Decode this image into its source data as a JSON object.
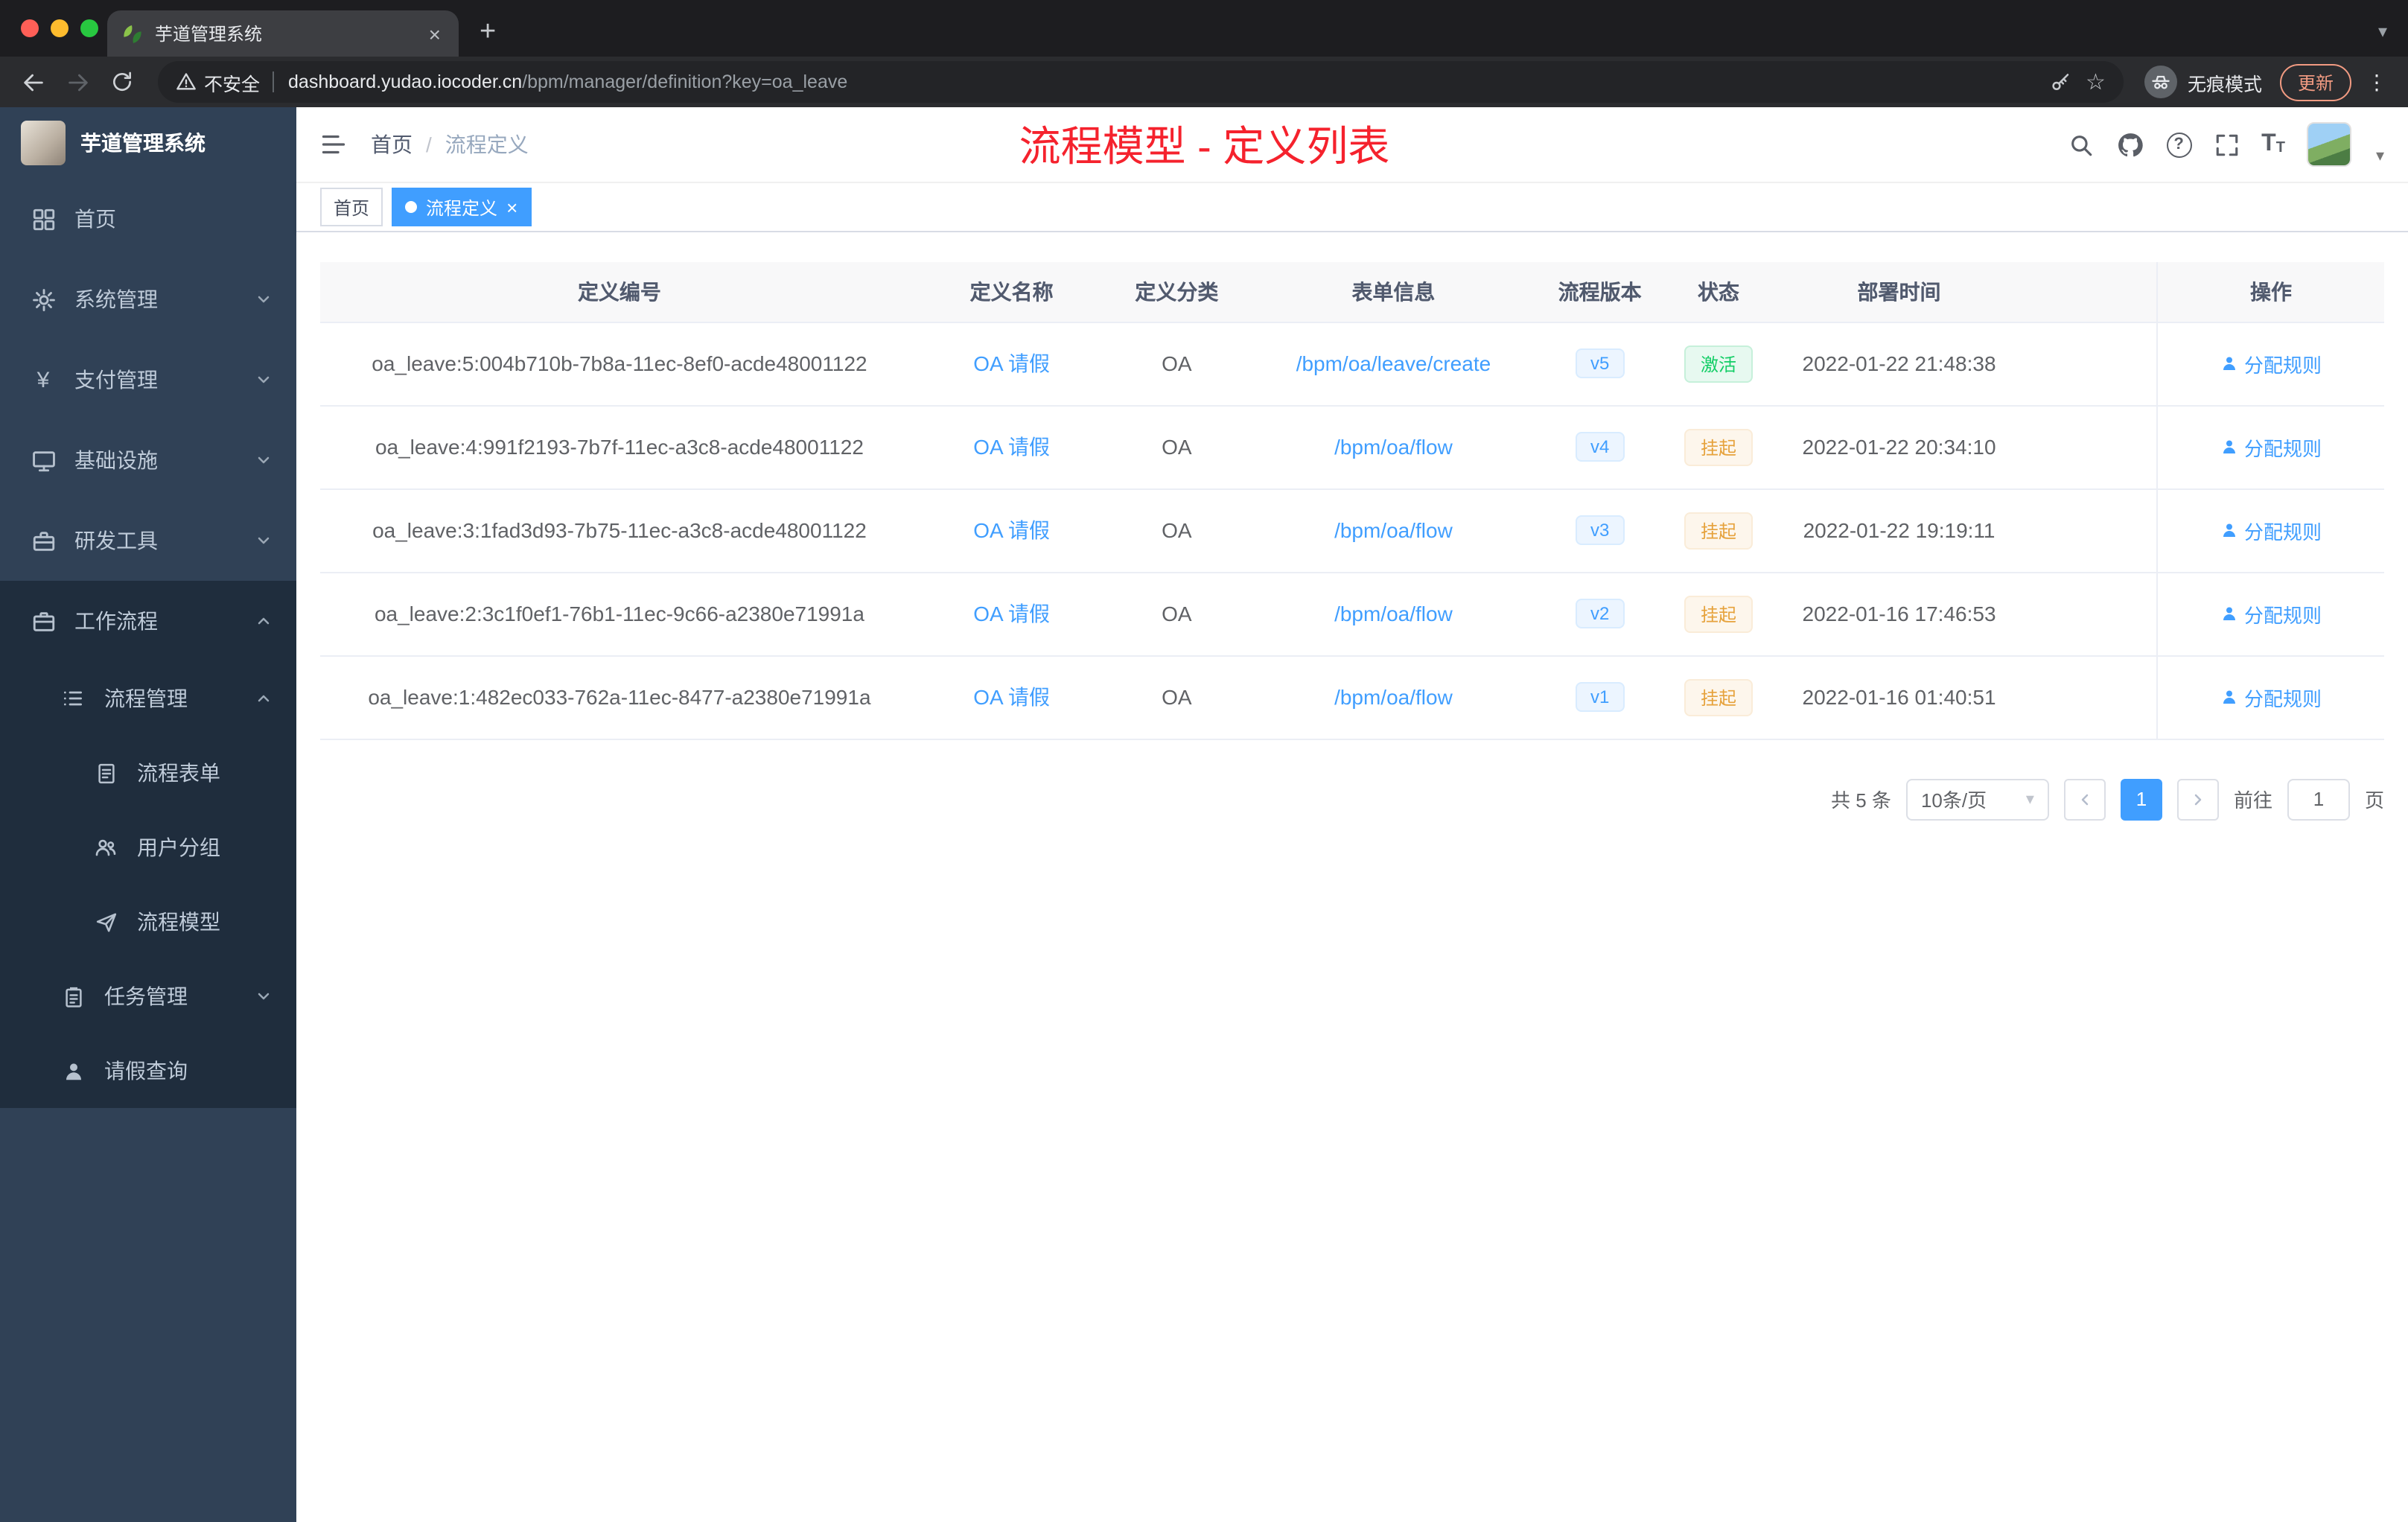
{
  "browser": {
    "tab": {
      "title": "芋道管理系统"
    },
    "security_label": "不安全",
    "url_host": "dashboard.yudao.iocoder.cn",
    "url_path": "/bpm/manager/definition?key=oa_leave",
    "incognito_label": "无痕模式",
    "update_label": "更新"
  },
  "icons": {
    "close": "×",
    "plus": "+",
    "star": "☆",
    "kebab": "⋮",
    "caret_down": "▾",
    "yen": "¥",
    "question": "?",
    "font_size_big": "T",
    "font_size_small": "T"
  },
  "sidebar": {
    "logo_title": "芋道管理系统",
    "items": [
      {
        "label": "首页"
      },
      {
        "label": "系统管理"
      },
      {
        "label": "支付管理"
      },
      {
        "label": "基础设施"
      },
      {
        "label": "研发工具"
      },
      {
        "label": "工作流程"
      }
    ],
    "workflow": {
      "process_mgmt": "流程管理",
      "process_form": "流程表单",
      "user_group": "用户分组",
      "process_model": "流程模型",
      "task_mgmt": "任务管理",
      "leave_query": "请假查询"
    }
  },
  "header": {
    "breadcrumb_home": "首页",
    "breadcrumb_sep": "/",
    "breadcrumb_current": "流程定义",
    "annotation": "流程模型 - 定义列表"
  },
  "tags": {
    "home": "首页",
    "current": "流程定义"
  },
  "table": {
    "headers": [
      "定义编号",
      "定义名称",
      "定义分类",
      "表单信息",
      "流程版本",
      "状态",
      "部署时间",
      "操作"
    ],
    "rows": [
      {
        "id": "oa_leave:5:004b710b-7b8a-11ec-8ef0-acde48001122",
        "name": "OA 请假",
        "category": "OA",
        "form": "/bpm/oa/leave/create",
        "version": "v5",
        "status": "激活",
        "time": "2022-01-22 21:48:38",
        "action": "分配规则"
      },
      {
        "id": "oa_leave:4:991f2193-7b7f-11ec-a3c8-acde48001122",
        "name": "OA 请假",
        "category": "OA",
        "form": "/bpm/oa/flow",
        "version": "v4",
        "status": "挂起",
        "time": "2022-01-22 20:34:10",
        "action": "分配规则"
      },
      {
        "id": "oa_leave:3:1fad3d93-7b75-11ec-a3c8-acde48001122",
        "name": "OA 请假",
        "category": "OA",
        "form": "/bpm/oa/flow",
        "version": "v3",
        "status": "挂起",
        "time": "2022-01-22 19:19:11",
        "action": "分配规则"
      },
      {
        "id": "oa_leave:2:3c1f0ef1-76b1-11ec-9c66-a2380e71991a",
        "name": "OA 请假",
        "category": "OA",
        "form": "/bpm/oa/flow",
        "version": "v2",
        "status": "挂起",
        "time": "2022-01-16 17:46:53",
        "action": "分配规则"
      },
      {
        "id": "oa_leave:1:482ec033-762a-11ec-8477-a2380e71991a",
        "name": "OA 请假",
        "category": "OA",
        "form": "/bpm/oa/flow",
        "version": "v1",
        "status": "挂起",
        "time": "2022-01-16 01:40:51",
        "action": "分配规则"
      }
    ]
  },
  "pagination": {
    "total": "共 5 条",
    "page_size": "10条/页",
    "current_page": "1",
    "jump_prefix": "前往",
    "jump_value": "1",
    "jump_suffix": "页"
  },
  "colors": {
    "accent": "#409eff",
    "success": "#13ce66",
    "warning": "#e6a23c",
    "annotation_red": "#f5222d",
    "sidebar_bg": "#304156",
    "submenu_bg": "#1f2d3d"
  }
}
